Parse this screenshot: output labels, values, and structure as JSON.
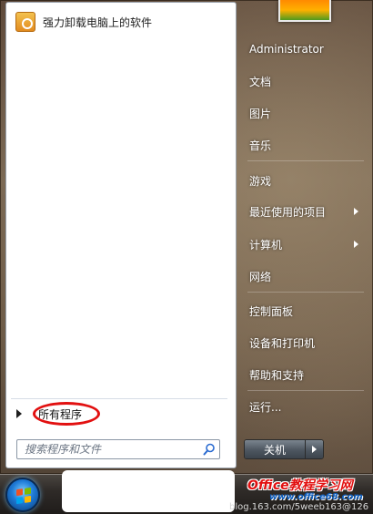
{
  "start_menu": {
    "pinned": [
      {
        "label": "强力卸载电脑上的软件",
        "icon": "uninstaller-icon"
      }
    ],
    "all_programs_label": "所有程序",
    "search": {
      "placeholder": "搜索程序和文件",
      "value": ""
    },
    "right_items": [
      {
        "label": "Administrator",
        "has_arrow": false
      },
      {
        "label": "文档",
        "has_arrow": false
      },
      {
        "label": "图片",
        "has_arrow": false
      },
      {
        "label": "音乐",
        "has_arrow": false
      },
      {
        "label": "游戏",
        "has_arrow": false
      },
      {
        "label": "最近使用的项目",
        "has_arrow": true
      },
      {
        "label": "计算机",
        "has_arrow": true
      },
      {
        "label": "网络",
        "has_arrow": false
      },
      {
        "label": "控制面板",
        "has_arrow": false
      },
      {
        "label": "设备和打印机",
        "has_arrow": false
      },
      {
        "label": "帮助和支持",
        "has_arrow": false
      },
      {
        "label": "运行...",
        "has_arrow": false
      }
    ],
    "shutdown_label": "关机"
  },
  "watermark": {
    "site": "Office教程学习网",
    "url": "www.office68.com",
    "blog": "blog.163.com/5weeb163@126"
  },
  "colors": {
    "highlight_ring": "#e21010",
    "menu_text_right": "#ffffff",
    "orb_blue": "#1e7ad6"
  }
}
